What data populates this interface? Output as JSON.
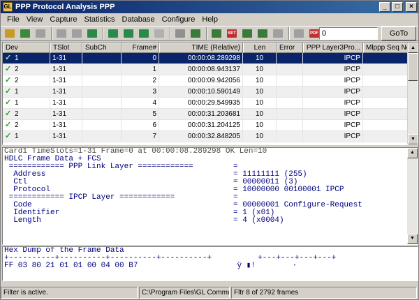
{
  "window": {
    "title": "PPP Protocol Analysis PPP",
    "app_icon": "GL"
  },
  "menu": [
    "File",
    "View",
    "Capture",
    "Statistics",
    "Database",
    "Configure",
    "Help"
  ],
  "toolbar": {
    "goto_value": "0",
    "goto_label": "GoTo",
    "buttons": [
      {
        "icon": "open-folder-icon",
        "color": "#c89a2a"
      },
      {
        "icon": "load-icon",
        "color": "#3a8a3a"
      },
      {
        "icon": "refresh-icon",
        "color": "#a0a0a0"
      },
      {
        "icon": "stop-icon",
        "color": "#a0a0a0"
      },
      {
        "icon": "no-entry-icon",
        "color": "#a0a0a0"
      },
      {
        "icon": "first-frame-icon",
        "color": "#2a8a4a"
      },
      {
        "icon": "prev-frame-icon",
        "color": "#2a8a4a"
      },
      {
        "icon": "next-frame-icon",
        "color": "#2a8a4a"
      },
      {
        "icon": "last-frame-icon",
        "color": "#2a8a4a"
      },
      {
        "icon": "grid-icon",
        "color": "#b0b0b0"
      },
      {
        "icon": "record-icon",
        "color": "#909090"
      },
      {
        "icon": "filter-icon",
        "color": "#3a7a3a"
      },
      {
        "icon": "filter-clear-icon",
        "color": "#3a7a3a"
      },
      {
        "icon": "set-filter-icon",
        "color": "#c03030"
      },
      {
        "icon": "search-icon",
        "color": "#3a7a3a"
      },
      {
        "icon": "search-clear-icon",
        "color": "#3a7a3a"
      },
      {
        "icon": "export-icon",
        "color": "#a0a0a0"
      },
      {
        "icon": "import-icon",
        "color": "#a0a0a0"
      },
      {
        "icon": "pdf-icon",
        "color": "#c03030"
      }
    ],
    "badges": {
      "set": "SET",
      "pdf": "PDF"
    }
  },
  "table": {
    "columns": [
      "Dev",
      "TSlot",
      "SubCh",
      "Frame#",
      "TIME (Relative)",
      "Len",
      "Error",
      "PPP Layer3Pro...",
      "Mlppp Seq No"
    ],
    "rows": [
      {
        "dev": "1",
        "tslot": "1-31",
        "subch": "",
        "frame": "0",
        "time": "00:00:08.289298",
        "len": "10",
        "error": "",
        "l3": "IPCP",
        "mlppp": ""
      },
      {
        "dev": "2",
        "tslot": "1-31",
        "subch": "",
        "frame": "1",
        "time": "00:00:08.943137",
        "len": "10",
        "error": "",
        "l3": "IPCP",
        "mlppp": ""
      },
      {
        "dev": "2",
        "tslot": "1-31",
        "subch": "",
        "frame": "2",
        "time": "00:00:09.942056",
        "len": "10",
        "error": "",
        "l3": "IPCP",
        "mlppp": ""
      },
      {
        "dev": "1",
        "tslot": "1-31",
        "subch": "",
        "frame": "3",
        "time": "00:00:10.590149",
        "len": "10",
        "error": "",
        "l3": "IPCP",
        "mlppp": ""
      },
      {
        "dev": "1",
        "tslot": "1-31",
        "subch": "",
        "frame": "4",
        "time": "00:00:29.549935",
        "len": "10",
        "error": "",
        "l3": "IPCP",
        "mlppp": ""
      },
      {
        "dev": "2",
        "tslot": "1-31",
        "subch": "",
        "frame": "5",
        "time": "00:00:31.203681",
        "len": "10",
        "error": "",
        "l3": "IPCP",
        "mlppp": ""
      },
      {
        "dev": "2",
        "tslot": "1-31",
        "subch": "",
        "frame": "6",
        "time": "00:00:31.204125",
        "len": "10",
        "error": "",
        "l3": "IPCP",
        "mlppp": ""
      },
      {
        "dev": "1",
        "tslot": "1-31",
        "subch": "",
        "frame": "7",
        "time": "00:00:32.848205",
        "len": "10",
        "error": "",
        "l3": "IPCP",
        "mlppp": ""
      }
    ],
    "selected_index": 0,
    "check_mark": "✓"
  },
  "decode": {
    "summary": "Card1 TimeSlots=1-31 Frame=0 at 00:00:08.289298 OK Len=10",
    "lines": [
      {
        "label": "HDLC Frame Data + FCS",
        "value": ""
      },
      {
        "label": " ============ PPP Link Layer ============",
        "value": "="
      },
      {
        "label": "  Address",
        "value": "= 11111111 (255)"
      },
      {
        "label": "  Ctl",
        "value": "= 00000011 (3)"
      },
      {
        "label": "  Protocol",
        "value": "= 10000000 00100001 IPCP"
      },
      {
        "label": " ============ IPCP Layer ============",
        "value": "="
      },
      {
        "label": "  Code",
        "value": "= 00000001 Configure-Request"
      },
      {
        "label": "  Identifier",
        "value": "= 1 (x01)"
      },
      {
        "label": "  Length",
        "value": "= 4 (x0004)"
      }
    ]
  },
  "hex": {
    "title": "Hex Dump of the Frame Data",
    "ruler": "+----------+----------+----------+----------+          +---+---+---+---+",
    "bytes": "FF 03 80 21 01 01 00 04 00 B7",
    "ascii": "ÿ ▮!        ·"
  },
  "status": {
    "filter": "Filter is active.",
    "path": "C:\\Program Files\\GL Communications Inc\\...",
    "frames": "Fltr 8 of 2792 frames"
  }
}
